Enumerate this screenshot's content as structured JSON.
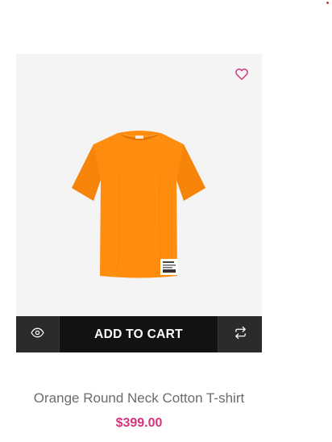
{
  "colors": {
    "accent": "#d6337e",
    "action_bar": "#121215",
    "image_bg": "#f4f4f4",
    "shirt": "#fd8c0f"
  },
  "product": {
    "title": "Orange Round Neck Cotton T-shirt",
    "price": "$399.00",
    "image_alt": "orange-tshirt-image"
  },
  "actions": {
    "add_to_cart_label": "ADD TO CART",
    "quick_view_icon": "eye-icon",
    "compare_icon": "compare-arrows-icon",
    "wishlist_icon": "heart-icon"
  }
}
